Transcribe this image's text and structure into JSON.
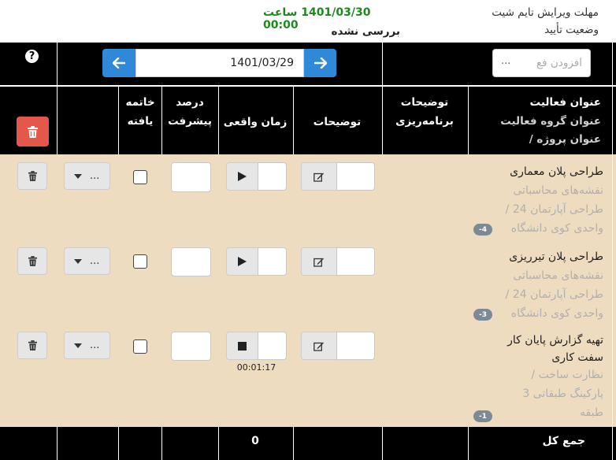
{
  "header": {
    "deadline_label": "مهلت ویرایش تایم شیت",
    "status_label": "وضعیت تأیید",
    "deadline_value": "1401/03/30 ساعت 00:00",
    "status_value": "بررسی نشده"
  },
  "toolbar": {
    "help_icon": "question-circle-icon",
    "date": "1401/03/29",
    "add_placeholder": "افزودن فع",
    "add_dots": "..."
  },
  "columns": {
    "activity_title": "عنوان فعالیت",
    "activity_group": "عنوان گروه فعالیت",
    "project": "/ عنوان پروژه",
    "planning_desc_1": "توضیحات",
    "planning_desc_2": "برنامه‌ریزی",
    "description": "توضیحات",
    "actual_time": "زمان واقعی",
    "progress_1": "درصد",
    "progress_2": "پیشرفت",
    "finished_1": "خاتمه",
    "finished_2": "یافته"
  },
  "rows": [
    {
      "title_lines": [
        "طراحی پلان معماری"
      ],
      "sub_lines": [
        "نقشه‌های محاسباتی",
        "/ طراحی آپارتمان 24",
        "واحدی کوی دانشگاه"
      ],
      "badge": "-4",
      "timer_icon": "play-icon",
      "timer": "",
      "dropdown": "..."
    },
    {
      "title_lines": [
        "طراحی پلان تیرریزی"
      ],
      "sub_lines": [
        "نقشه‌های محاسباتی",
        "/ طراحی آپارتمان 24",
        "واحدی کوی دانشگاه"
      ],
      "badge": "-3",
      "timer_icon": "play-icon",
      "timer": "",
      "dropdown": "..."
    },
    {
      "title_lines": [
        "تهیه گزارش پایان کار",
        "سفت کاری"
      ],
      "sub_lines": [
        "/ نظارت ساخت",
        "پارکینگ طبقاتی 3",
        "طبقه"
      ],
      "badge": "-1",
      "timer_icon": "stop-icon",
      "timer": "00:01:17",
      "dropdown": "..."
    }
  ],
  "footer": {
    "total_label": "جمع کل",
    "total_value": "0"
  },
  "colors": {
    "deadline_green": "#1a8a1a",
    "row_bg": "#eddcbf",
    "nav_blue": "#2f88d8",
    "delete_red": "#e4574a"
  }
}
